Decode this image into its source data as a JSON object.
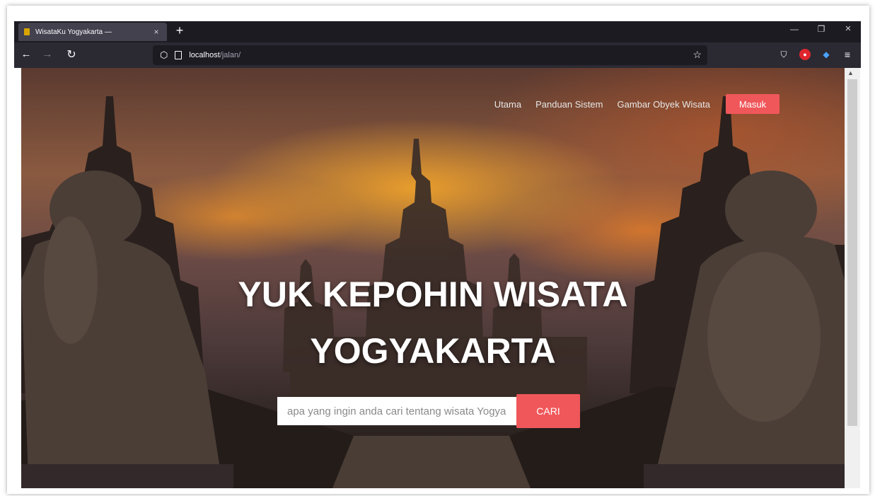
{
  "browser": {
    "tab_title": "WisataKu Yogyakarta —",
    "tab_close": "×",
    "new_tab": "+",
    "url_host": "localhost",
    "url_path": "/jalan/",
    "window_controls": {
      "minimize": "—",
      "restore": "❐",
      "close": "×"
    },
    "nav_icons": {
      "back": "←",
      "forward": "→",
      "reload": "↻",
      "bookmark": "☆"
    }
  },
  "site": {
    "nav": {
      "links": [
        "Utama",
        "Panduan Sistem",
        "Gambar Obyek Wisata"
      ],
      "login_label": "Masuk"
    },
    "hero": {
      "line1": "YUK KEPOHIN WISATA",
      "line2": "YOGYAKARTA"
    },
    "search": {
      "placeholder": "apa yang ingin anda cari tentang wisata Yogyakarta",
      "button_label": "CARI"
    }
  },
  "colors": {
    "accent": "#f0575a",
    "chrome_dark": "#1c1b22",
    "chrome_toolbar": "#2b2a33"
  }
}
